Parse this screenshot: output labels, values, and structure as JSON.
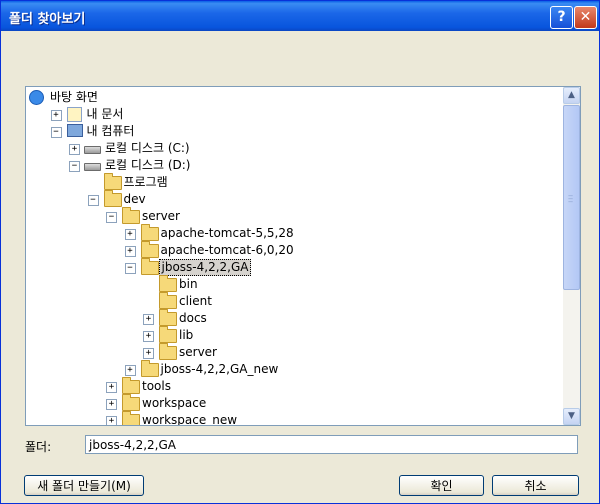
{
  "window": {
    "title": "폴더 찾아보기",
    "help_label": "?",
    "close_label": "✕"
  },
  "tree": {
    "items": [
      {
        "label": "바탕 화면",
        "icon": "desktop-icon"
      },
      {
        "label": "내 문서",
        "icon": "my-documents-icon",
        "expander": "+"
      },
      {
        "label": "내 컴퓨터",
        "icon": "my-computer-icon",
        "expander": "−"
      },
      {
        "label": "로컬 디스크 (C:)",
        "icon": "drive-icon",
        "expander": "+"
      },
      {
        "label": "로컬 디스크 (D:)",
        "icon": "drive-icon",
        "expander": "−"
      },
      {
        "label": "프로그램",
        "icon": "folder-icon"
      },
      {
        "label": "dev",
        "icon": "folder-icon",
        "expander": "−"
      },
      {
        "label": "server",
        "icon": "folder-icon",
        "expander": "−"
      },
      {
        "label": "apache-tomcat-5,5,28",
        "icon": "folder-icon",
        "expander": "+"
      },
      {
        "label": "apache-tomcat-6,0,20",
        "icon": "folder-icon",
        "expander": "+"
      },
      {
        "label": "jboss-4,2,2,GA",
        "icon": "folder-open-icon",
        "expander": "−",
        "selected": true
      },
      {
        "label": "bin",
        "icon": "folder-icon"
      },
      {
        "label": "client",
        "icon": "folder-icon"
      },
      {
        "label": "docs",
        "icon": "folder-icon",
        "expander": "+"
      },
      {
        "label": "lib",
        "icon": "folder-icon",
        "expander": "+"
      },
      {
        "label": "server",
        "icon": "folder-icon",
        "expander": "+"
      },
      {
        "label": "jboss-4,2,2,GA_new",
        "icon": "folder-icon",
        "expander": "+"
      },
      {
        "label": "tools",
        "icon": "folder-icon",
        "expander": "+"
      },
      {
        "label": "workspace",
        "icon": "folder-icon",
        "expander": "+"
      },
      {
        "label": "workspace_new",
        "icon": "folder-icon",
        "expander": "+"
      }
    ]
  },
  "folder_field": {
    "label": "폴더:",
    "value": "jboss-4,2,2,GA"
  },
  "buttons": {
    "new_folder": "새 폴더 만들기(M)",
    "ok": "확인",
    "cancel": "취소"
  },
  "scrollbar": {
    "up_arrow": "▲",
    "down_arrow": "▼"
  },
  "colors": {
    "titlebar": "#0855dd",
    "selection": "#d6d3ce",
    "dialog_bg": "#ece9d8"
  }
}
